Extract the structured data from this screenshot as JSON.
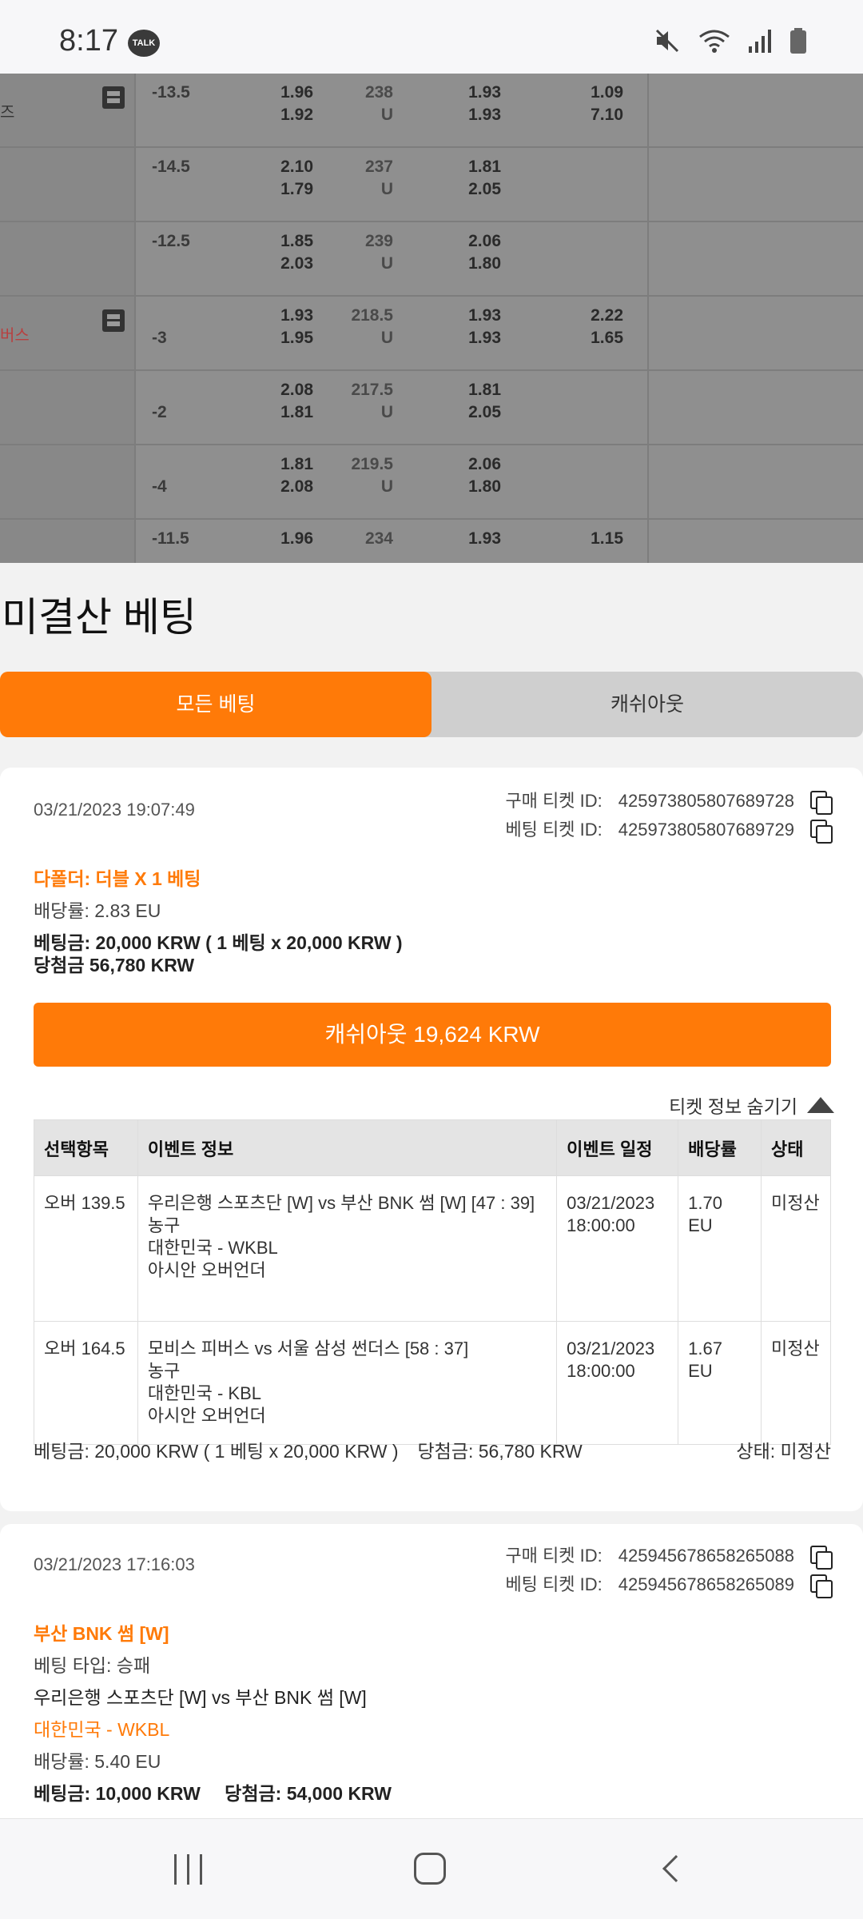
{
  "status_bar": {
    "time": "8:17",
    "talk_badge": "TALK"
  },
  "odds_overlay": {
    "rows": [
      {
        "spread": "-13.5",
        "o1a": "1.96",
        "o1b": "1.92",
        "tot": "238",
        "totu": "U",
        "o2a": "1.93",
        "o2b": "1.93",
        "o3a": "1.09",
        "o3b": "7.10",
        "team": "즈",
        "icon": true
      },
      {
        "spread": "-14.5",
        "o1a": "2.10",
        "o1b": "1.79",
        "tot": "237",
        "totu": "U",
        "o2a": "1.81",
        "o2b": "2.05",
        "o3a": "",
        "o3b": ""
      },
      {
        "spread": "-12.5",
        "o1a": "1.85",
        "o1b": "2.03",
        "tot": "239",
        "totu": "U",
        "o2a": "2.06",
        "o2b": "1.80",
        "o3a": "",
        "o3b": ""
      },
      {
        "spread": "-3",
        "o1a": "1.93",
        "o1b": "1.95",
        "tot": "218.5",
        "totu": "U",
        "o2a": "1.93",
        "o2b": "1.93",
        "o3a": "2.22",
        "o3b": "1.65",
        "team": "버스",
        "icon": true
      },
      {
        "spread": "-2",
        "o1a": "2.08",
        "o1b": "1.81",
        "tot": "217.5",
        "totu": "U",
        "o2a": "1.81",
        "o2b": "2.05",
        "o3a": "",
        "o3b": ""
      },
      {
        "spread": "-4",
        "o1a": "1.81",
        "o1b": "2.08",
        "tot": "219.5",
        "totu": "U",
        "o2a": "2.06",
        "o2b": "1.80",
        "o3a": "",
        "o3b": ""
      },
      {
        "spread": "-11.5",
        "o1a": "1.96",
        "o1b": "",
        "tot": "234",
        "totu": "",
        "o2a": "1.93",
        "o2b": "",
        "o3a": "1.15",
        "o3b": ""
      }
    ]
  },
  "sheet": {
    "title": "미결산 베팅",
    "tabs": {
      "all": "모든 베팅",
      "cashout": "캐쉬아웃"
    }
  },
  "card1": {
    "date": "03/21/2023 19:07:49",
    "purchase_label": "구매 티켓 ID:",
    "purchase_id": "425973805807689728",
    "bet_label": "베팅 티켓 ID:",
    "bet_id": "425973805807689729",
    "bet_type": "다폴더: 더블 X 1 베팅",
    "odds": "배당률: 2.83 EU",
    "stake": "베팅금: 20,000 KRW ( 1 베팅 x 20,000 KRW )",
    "payout": "당첨금 56,780 KRW",
    "cashout_button": "캐쉬아웃 19,624 KRW",
    "hide_info": "티켓 정보 숨기기",
    "table": {
      "headers": [
        "선택항목",
        "이벤트 정보",
        "이벤트 일정",
        "배당률",
        "상태"
      ],
      "rows": [
        {
          "selection": "오버 139.5",
          "event": "우리은행 스포츠단 [W] vs 부산 BNK 썸 [W] [47 : 39]",
          "sport": "농구",
          "league": "대한민국 - WKBL",
          "market": "아시안 오버언더",
          "date": "03/21/2023 18:00:00",
          "odds": "1.70 EU",
          "status": "미정산"
        },
        {
          "selection": "오버 164.5",
          "event": "모비스 피버스 vs 서울 삼성 썬더스 [58 : 37]",
          "sport": "농구",
          "league": "대한민국 - KBL",
          "market": "아시안 오버언더",
          "date": "03/21/2023 18:00:00",
          "odds": "1.67 EU",
          "status": "미정산"
        }
      ]
    },
    "footer_stake": "베팅금: 20,000 KRW ( 1 베팅 x 20,000 KRW )",
    "footer_payout": "당첨금: 56,780 KRW",
    "footer_status": "상태: 미정산"
  },
  "card2": {
    "date": "03/21/2023 17:16:03",
    "purchase_label": "구매 티켓 ID:",
    "purchase_id": "425945678658265088",
    "bet_label": "베팅 티켓 ID:",
    "bet_id": "425945678658265089",
    "selection": "부산 BNK 썸 [W]",
    "bet_type": "베팅 타입: 승패",
    "match": "우리은행 스포츠단 [W] vs 부산 BNK 썸 [W]",
    "league": "대한민국 - WKBL",
    "odds": "배당률: 5.40 EU",
    "stake": "베팅금: 10,000 KRW",
    "payout": "당첨금: 54,000 KRW"
  }
}
